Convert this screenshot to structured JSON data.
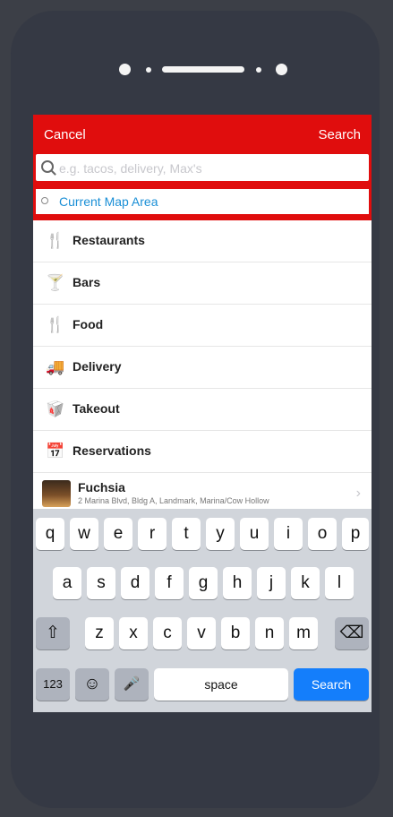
{
  "nav": {
    "cancel_label": "Cancel",
    "search_label": "Search"
  },
  "search": {
    "placeholder": "e.g. tacos, delivery, Max's"
  },
  "location": {
    "label": "Current Map Area"
  },
  "categories": [
    {
      "label": "Restaurants",
      "icon": "fork-knife-icon",
      "glyph": "🍴"
    },
    {
      "label": "Bars",
      "icon": "cocktail-icon",
      "glyph": "🍸"
    },
    {
      "label": "Food",
      "icon": "fork-knife-icon",
      "glyph": "🍴"
    },
    {
      "label": "Delivery",
      "icon": "truck-icon",
      "glyph": "🚚"
    },
    {
      "label": "Takeout",
      "icon": "takeout-bag-icon",
      "glyph": "🥡"
    },
    {
      "label": "Reservations",
      "icon": "calendar-icon",
      "glyph": "📅"
    }
  ],
  "place": {
    "name": "Fuchsia",
    "address": "2 Marina Blvd, Bldg A, Landmark, Marina/Cow Hollow"
  },
  "keyboard": {
    "row1": [
      "q",
      "w",
      "e",
      "r",
      "t",
      "y",
      "u",
      "i",
      "o",
      "p"
    ],
    "row2": [
      "a",
      "s",
      "d",
      "f",
      "g",
      "h",
      "j",
      "k",
      "l"
    ],
    "row3": [
      "z",
      "x",
      "c",
      "v",
      "b",
      "n",
      "m"
    ],
    "shift": "⇧",
    "backspace": "⌫",
    "numbers": "123",
    "emoji": "☺",
    "mic": "🎤",
    "space": "space",
    "search": "Search"
  }
}
